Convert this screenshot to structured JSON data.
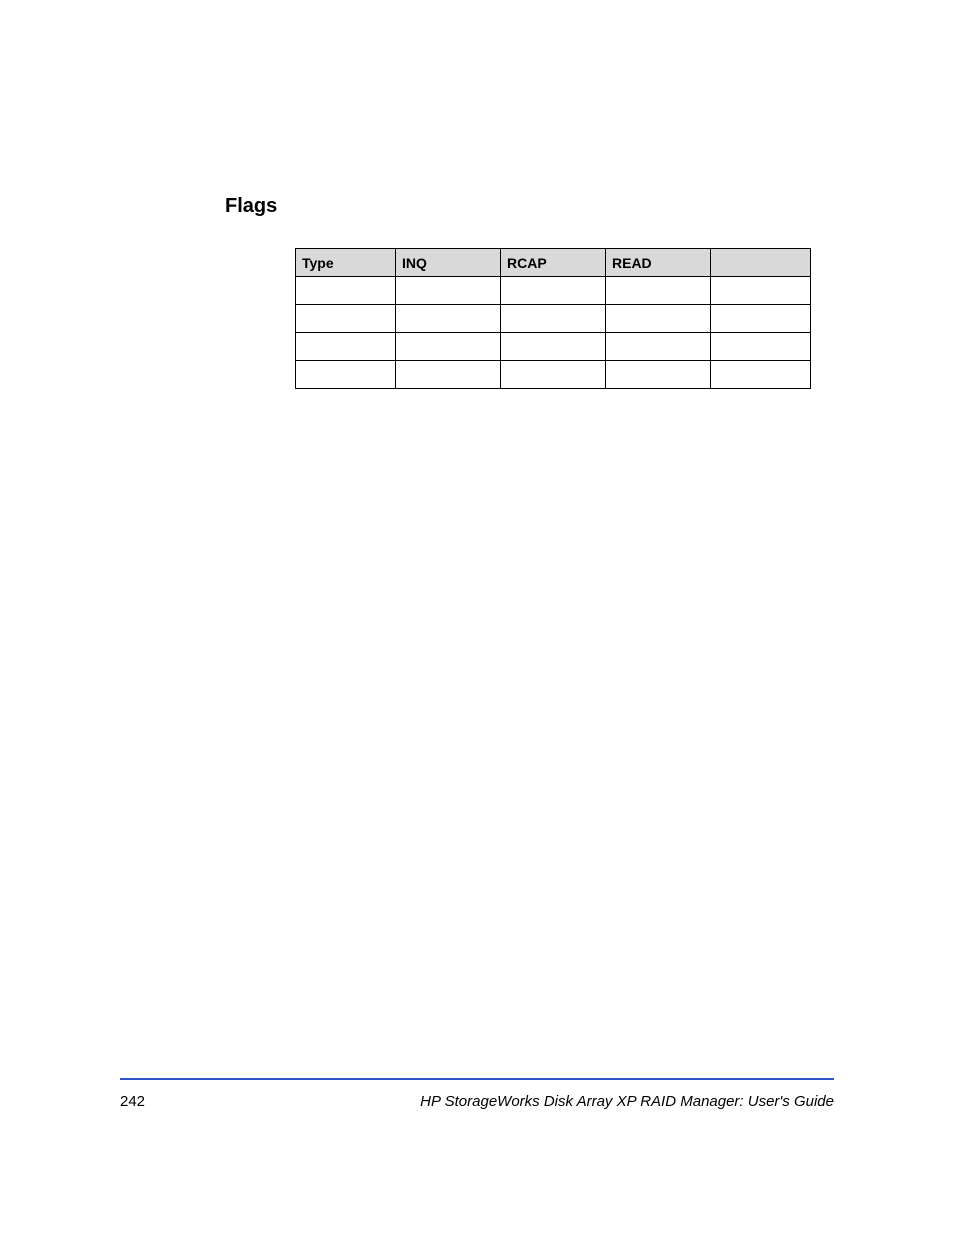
{
  "section_heading": "Flags",
  "table": {
    "headers": [
      "Type",
      "INQ",
      "RCAP",
      "READ",
      ""
    ],
    "rows": [
      [
        "",
        "",
        "",
        "",
        ""
      ],
      [
        "",
        "",
        "",
        "",
        ""
      ],
      [
        "",
        "",
        "",
        "",
        ""
      ],
      [
        "",
        "",
        "",
        "",
        ""
      ]
    ]
  },
  "footer": {
    "page_number": "242",
    "title": "HP StorageWorks Disk Array XP RAID Manager: User's Guide"
  }
}
